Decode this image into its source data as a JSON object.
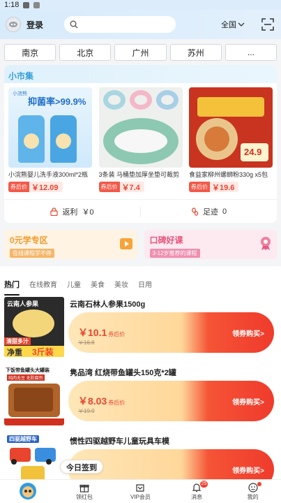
{
  "status": {
    "time": "1:18"
  },
  "header": {
    "login_label": "登录",
    "region": "全国"
  },
  "cities": [
    "南京",
    "北京",
    "广州",
    "苏州",
    "..."
  ],
  "market": {
    "title": "小市集",
    "products": [
      {
        "name": "小浣熊婴儿洗手液300ml*2瓶",
        "price_label": "券后价",
        "price": "￥12.09",
        "img_text": "抑菌率>99.9%"
      },
      {
        "name": "3条装 马桶垫加厚坐垫可裁剪",
        "price_label": "券后价",
        "price": "￥7.4"
      },
      {
        "name": "食益家柳州螺蛳粉330g x5包",
        "price_label": "券后价",
        "price": "￥19.6",
        "img_text": "24.9"
      }
    ],
    "stats": [
      {
        "label": "返利",
        "value": "￥0"
      },
      {
        "label": "足迹",
        "value": "0"
      }
    ]
  },
  "promos": [
    {
      "title": "0元学专区",
      "sub": "在线课程学不停"
    },
    {
      "title": "口碑好课",
      "sub": "3-12岁推荐的课程"
    }
  ],
  "tabs": [
    "热门",
    "在线教育",
    "儿童",
    "美食",
    "美妆",
    "日用"
  ],
  "feed": [
    {
      "title": "云南石林人参果1500g",
      "price": "￥10.1",
      "price_label": "券后价",
      "orig": "￥16.8",
      "cta": "领券购买>",
      "thumb_top": "云南人参果",
      "thumb_mid": "清甜多汁",
      "thumb_bottom": "净重",
      "thumb_tag": "3斤装"
    },
    {
      "title": "隽品湾 红烧带鱼罐头150克*2罐",
      "price": "￥8.03",
      "price_label": "券后价",
      "orig": "￥19.9",
      "cta": "领券购买>",
      "thumb_top": "下饭带鱼罐头大罐装",
      "thumb_mid": "纯肉无豆 无防腐剂"
    },
    {
      "title": "惯性四驱越野车儿童玩具车模",
      "price": "",
      "price_label": "",
      "orig": "",
      "cta": "领券购买>",
      "thumb_top": "四驱越野车"
    }
  ],
  "signin": "今日签到",
  "nav": [
    {
      "label": "",
      "icon": "mascot-icon"
    },
    {
      "label": "领红包",
      "icon": "gift-icon"
    },
    {
      "label": "VIP会员",
      "icon": "vip-icon"
    },
    {
      "label": "消息",
      "icon": "bell-icon",
      "badge": "25"
    },
    {
      "label": "我的",
      "icon": "user-icon"
    }
  ]
}
